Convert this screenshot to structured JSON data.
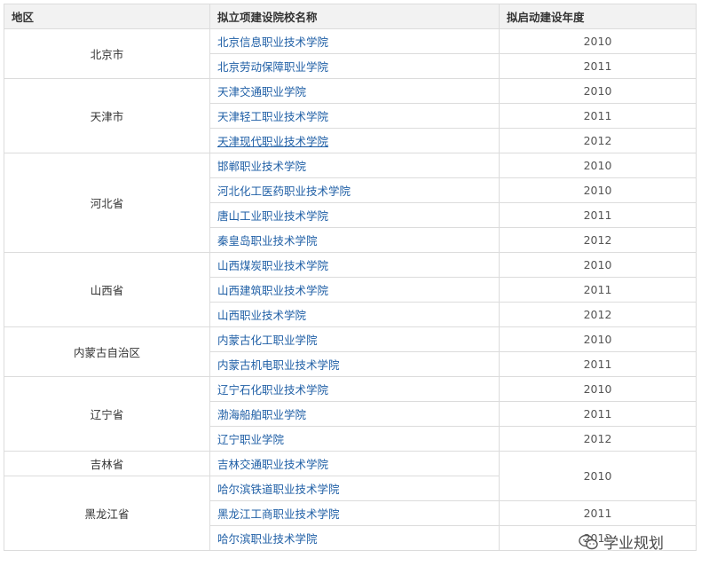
{
  "headers": {
    "region": "地区",
    "school": "拟立项建设院校名称",
    "year": "拟启动建设年度"
  },
  "regions": {
    "beijing": "北京市",
    "tianjin": "天津市",
    "hebei": "河北省",
    "shanxi": "山西省",
    "neimenggu": "内蒙古自治区",
    "liaoning": "辽宁省",
    "jilin": "吉林省",
    "heilongjiang": "黑龙江省"
  },
  "rows": [
    {
      "school": "北京信息职业技术学院",
      "year": "2010"
    },
    {
      "school": "北京劳动保障职业学院",
      "year": "2011"
    },
    {
      "school": "天津交通职业学院",
      "year": "2010"
    },
    {
      "school": "天津轻工职业技术学院",
      "year": "2011"
    },
    {
      "school": "天津现代职业技术学院",
      "year": "2012"
    },
    {
      "school": "邯郸职业技术学院",
      "year": "2010"
    },
    {
      "school": "河北化工医药职业技术学院",
      "year": "2010"
    },
    {
      "school": "唐山工业职业技术学院",
      "year": "2011"
    },
    {
      "school": "秦皇岛职业技术学院",
      "year": "2012"
    },
    {
      "school": "山西煤炭职业技术学院",
      "year": "2010"
    },
    {
      "school": "山西建筑职业技术学院",
      "year": "2011"
    },
    {
      "school": "山西职业技术学院",
      "year": "2012"
    },
    {
      "school": "内蒙古化工职业学院",
      "year": "2010"
    },
    {
      "school": "内蒙古机电职业技术学院",
      "year": "2011"
    },
    {
      "school": "辽宁石化职业技术学院",
      "year": "2010"
    },
    {
      "school": "渤海船舶职业学院",
      "year": "2011"
    },
    {
      "school": "辽宁职业学院",
      "year": "2012"
    },
    {
      "school": "吉林交通职业技术学院",
      "year": "2010"
    },
    {
      "school": "哈尔滨铁道职业技术学院",
      "year": ""
    },
    {
      "school": "黑龙江工商职业技术学院",
      "year": "2011"
    },
    {
      "school": "哈尔滨职业技术学院",
      "year": "2012"
    }
  ],
  "watermark": {
    "text": "学业规划",
    "icon": "wechat-icon"
  }
}
